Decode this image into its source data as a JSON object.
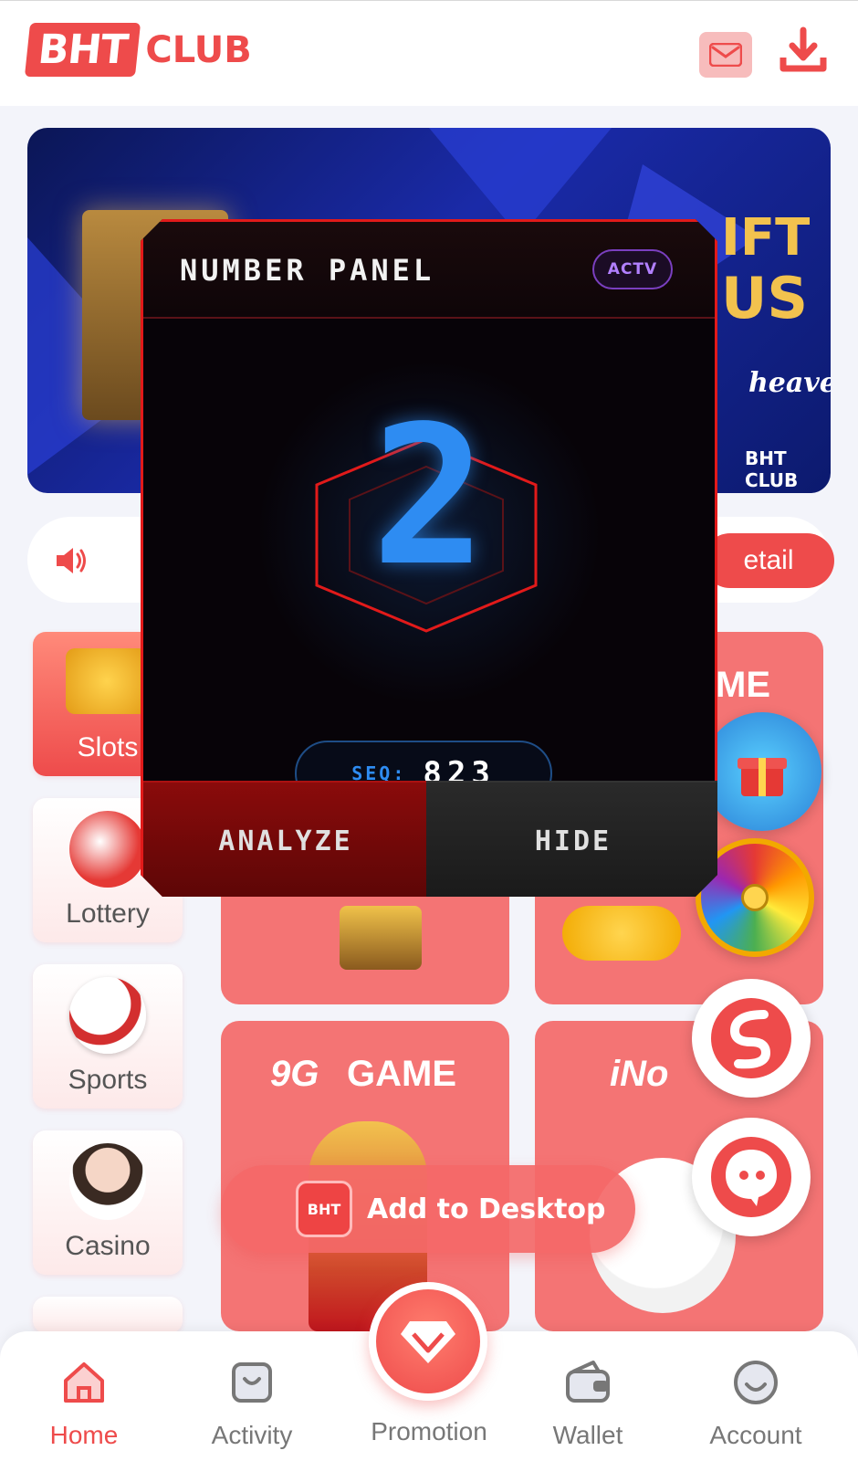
{
  "header": {
    "logo_badge": "BHT",
    "logo_club": "CLUB"
  },
  "banner": {
    "title_1": "IFT",
    "title_2": "US",
    "subtitle": "heaven",
    "brand": "BHT CLUB"
  },
  "notice": {
    "detail_label": "etail"
  },
  "categories": [
    {
      "label": "Slots"
    },
    {
      "label": "Lottery"
    },
    {
      "label": "Sports"
    },
    {
      "label": "Casino"
    }
  ],
  "tiles": {
    "top_right_title": "ME",
    "bottom_left_title": "GAME",
    "bottom_left_logo": "9G",
    "bottom_right_title": "iNo"
  },
  "add_desktop": {
    "logo": "BHT",
    "label": "Add to Desktop"
  },
  "nav": [
    {
      "label": "Home",
      "active": true
    },
    {
      "label": "Activity",
      "active": false
    },
    {
      "label": "Promotion",
      "active": false
    },
    {
      "label": "Wallet",
      "active": false
    },
    {
      "label": "Account",
      "active": false
    }
  ],
  "panel": {
    "title": "NUMBER PANEL",
    "status": "ACTV",
    "number": "2",
    "seq_label": "SEQ:",
    "seq_value": "823",
    "analyze_label": "ANALYZE",
    "hide_label": "HIDE"
  },
  "colors": {
    "brand_red": "#ee4b4b",
    "panel_border": "#e11a1a",
    "digit_blue": "#2e8cf2",
    "status_purple": "#b280ff"
  }
}
